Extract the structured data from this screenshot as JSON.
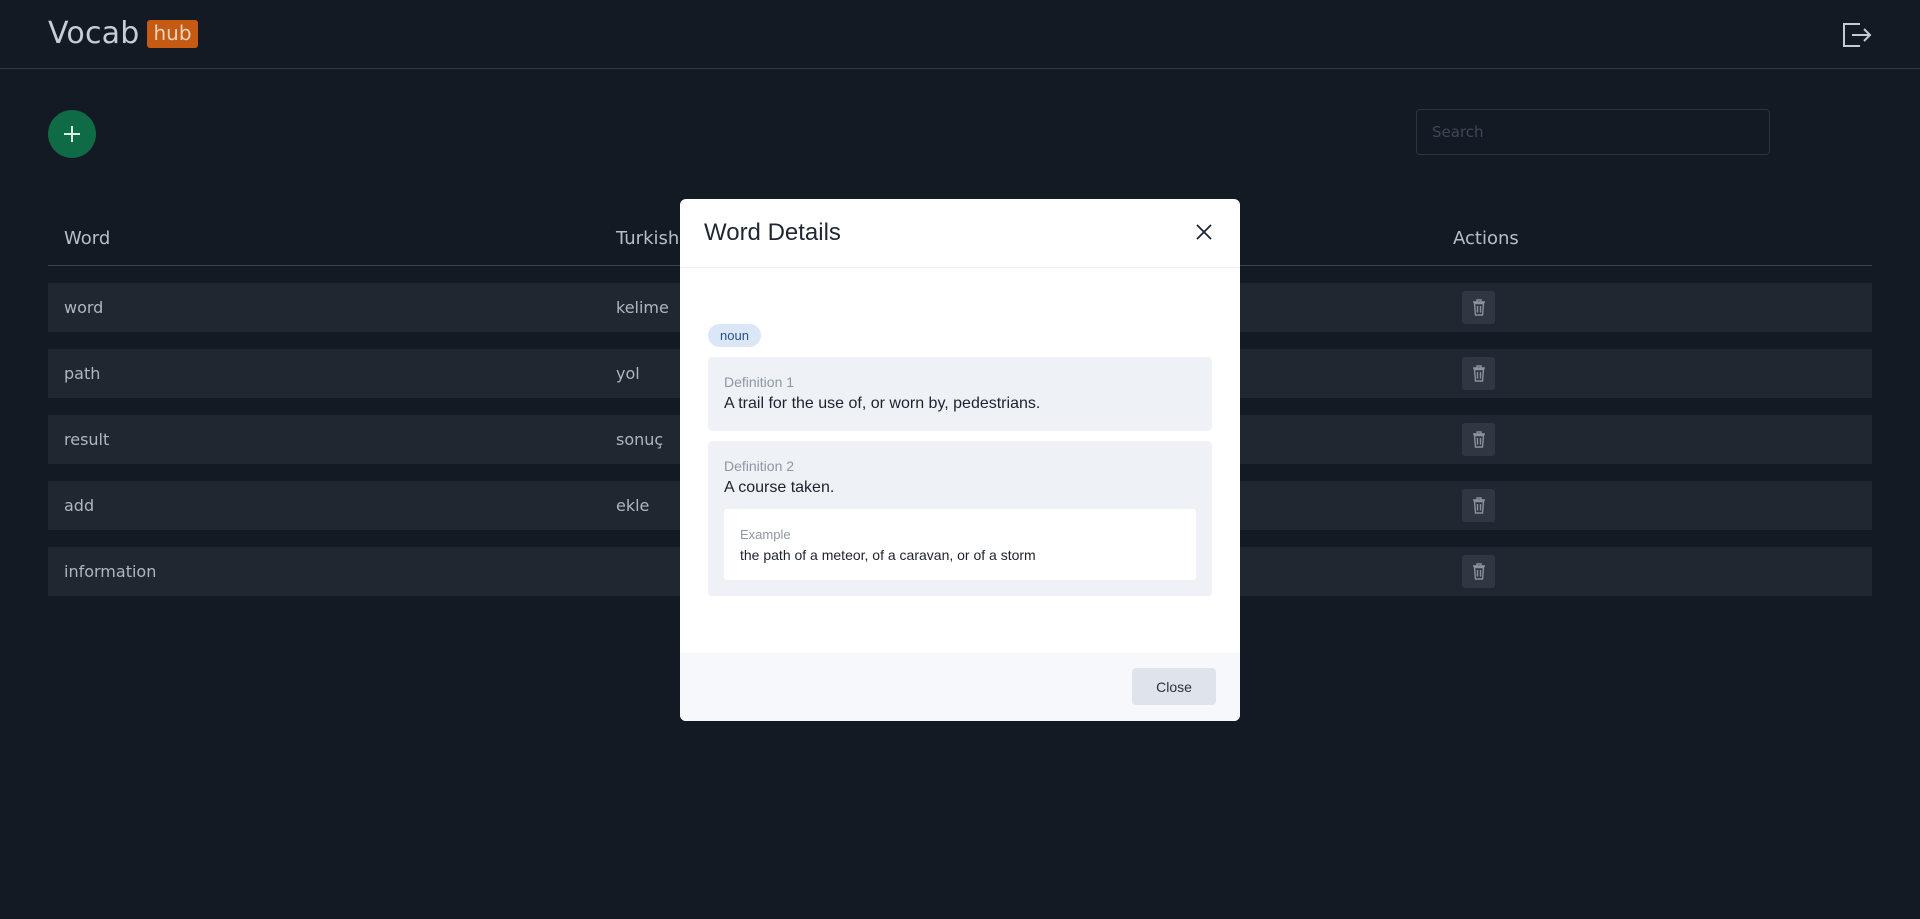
{
  "brand": {
    "name": "Vocab",
    "badge": "hub",
    "badge_color": "#c65a12"
  },
  "header": {
    "logout_icon": "logout-icon"
  },
  "toolbar": {
    "add_icon": "plus-icon",
    "search_placeholder": "Search"
  },
  "table": {
    "columns": [
      "Word",
      "Turkish",
      "Actions"
    ],
    "rows": [
      {
        "word": "word",
        "turkish": "kelime"
      },
      {
        "word": "path",
        "turkish": "yol"
      },
      {
        "word": "result",
        "turkish": "sonuç"
      },
      {
        "word": "add",
        "turkish": "ekle"
      },
      {
        "word": "information",
        "turkish": ""
      }
    ],
    "delete_icon": "trash-icon"
  },
  "modal": {
    "title": "Word Details",
    "part_of_speech": "noun",
    "definitions": [
      {
        "label": "Definition 1",
        "text": "A trail for the use of, or worn by, pedestrians."
      },
      {
        "label": "Definition 2",
        "text": "A course taken.",
        "example_label": "Example",
        "example": "the path of a meteor, of a caravan, or of a storm"
      }
    ],
    "close_label": "Close"
  }
}
